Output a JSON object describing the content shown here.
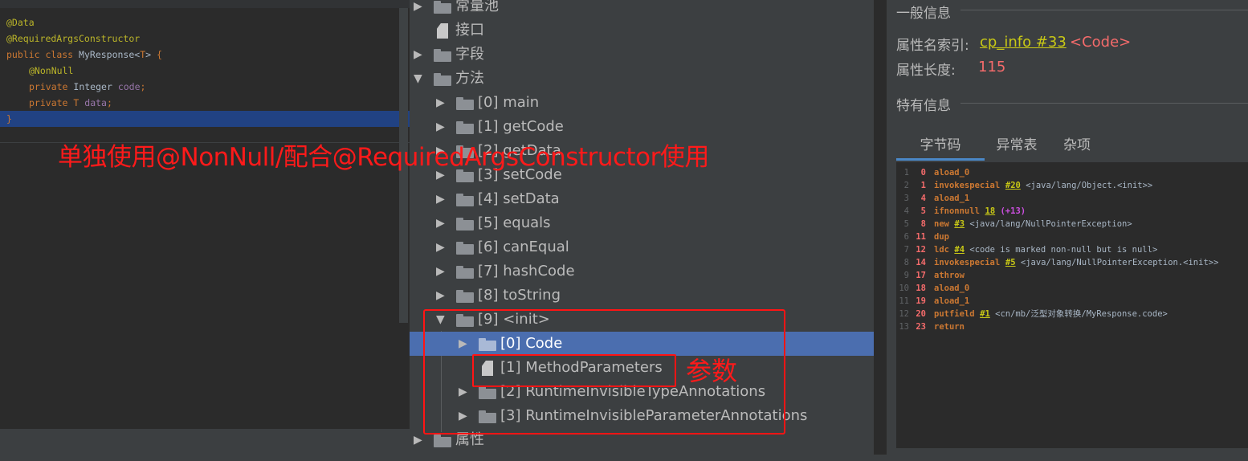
{
  "editor": {
    "lines": [
      {
        "a": "@Data"
      },
      {
        "a": "@RequiredArgsConstructor"
      },
      {
        "k1": "public",
        "k2": "class",
        "name": "MyResponse",
        "lt": "<",
        "t": "T",
        "gt": ">",
        "brace": "{"
      },
      {
        "a": "@NonNull"
      },
      {
        "k": "private",
        "type": "Integer",
        "f": "code",
        "semi": ";"
      },
      {
        "k": "private",
        "type": "T",
        "f": "data",
        "semi": ";"
      },
      {
        "brace": "}"
      }
    ],
    "overlay_text": "单独使用@NonNull/配合@RequiredArgsConstructor使用"
  },
  "tree": {
    "items": [
      {
        "label": "常量池"
      },
      {
        "label": "接口"
      },
      {
        "label": "字段"
      },
      {
        "label": "方法"
      },
      {
        "label": "[0] main"
      },
      {
        "label": "[1] getCode"
      },
      {
        "label": "[2] getData"
      },
      {
        "label": "[3] setCode"
      },
      {
        "label": "[4] setData"
      },
      {
        "label": "[5] equals"
      },
      {
        "label": "[6] canEqual"
      },
      {
        "label": "[7] hashCode"
      },
      {
        "label": "[8] toString"
      },
      {
        "label": "[9] <init>"
      },
      {
        "label": "[0] Code"
      },
      {
        "label": "[1] MethodParameters"
      },
      {
        "label": "[2] RuntimeInvisibleTypeAnnotations"
      },
      {
        "label": "[3] RuntimeInvisibleParameterAnnotations"
      },
      {
        "label": "属性"
      }
    ],
    "note": "参数"
  },
  "info": {
    "general_title": "一般信息",
    "attr_name_index_label": "属性名索引:",
    "attr_name_index_link": "cp_info #33",
    "attr_name_index_value": "<Code>",
    "attr_length_label": "属性长度:",
    "attr_length_value": "115",
    "specific_title": "特有信息",
    "tabs": [
      "字节码",
      "异常表",
      "杂项"
    ]
  },
  "bytecode": [
    {
      "ln": "1",
      "off": "0",
      "op": "aload_0"
    },
    {
      "ln": "2",
      "off": "1",
      "op": "invokespecial",
      "ref": "#20",
      "txt": "<java/lang/Object.<init>>"
    },
    {
      "ln": "3",
      "off": "4",
      "op": "aload_1"
    },
    {
      "ln": "4",
      "off": "5",
      "op": "ifnonnull",
      "ref": "18",
      "rel": "(+13)"
    },
    {
      "ln": "5",
      "off": "8",
      "op": "new",
      "ref": "#3",
      "txt": "<java/lang/NullPointerException>"
    },
    {
      "ln": "6",
      "off": "11",
      "op": "dup"
    },
    {
      "ln": "7",
      "off": "12",
      "op": "ldc",
      "ref": "#4",
      "txt": "<code is marked non-null but is null>"
    },
    {
      "ln": "8",
      "off": "14",
      "op": "invokespecial",
      "ref": "#5",
      "txt": "<java/lang/NullPointerException.<init>>"
    },
    {
      "ln": "9",
      "off": "17",
      "op": "athrow"
    },
    {
      "ln": "10",
      "off": "18",
      "op": "aload_0"
    },
    {
      "ln": "11",
      "off": "19",
      "op": "aload_1"
    },
    {
      "ln": "12",
      "off": "20",
      "op": "putfield",
      "ref": "#1",
      "txt": "<cn/mb/泛型对象转换/MyResponse.code>"
    },
    {
      "ln": "13",
      "off": "23",
      "op": "return"
    }
  ]
}
